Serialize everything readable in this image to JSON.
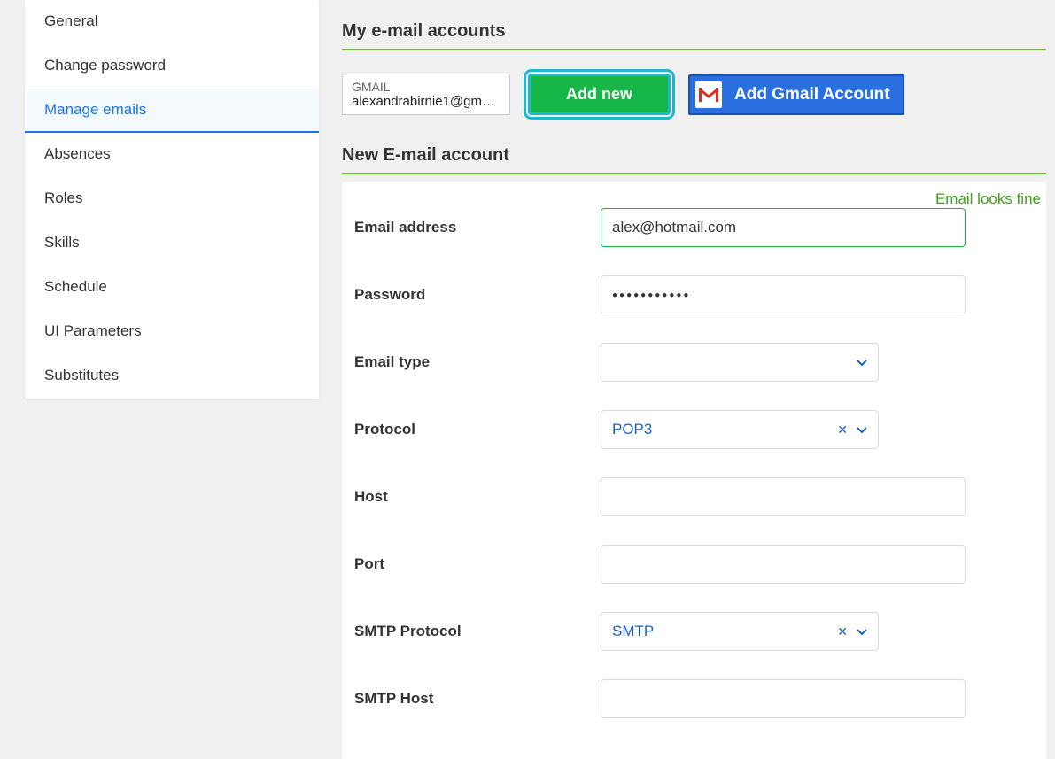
{
  "sidebar": {
    "items": [
      {
        "label": "General"
      },
      {
        "label": "Change password"
      },
      {
        "label": "Manage emails"
      },
      {
        "label": "Absences"
      },
      {
        "label": "Roles"
      },
      {
        "label": "Skills"
      },
      {
        "label": "Schedule"
      },
      {
        "label": "UI Parameters"
      },
      {
        "label": "Substitutes"
      }
    ],
    "active_index": 2
  },
  "sections": {
    "accounts_title": "My e-mail accounts",
    "new_account_title": "New E-mail account"
  },
  "existing_account": {
    "provider": "GMAIL",
    "email": "alexandrabirnie1@gmail..."
  },
  "buttons": {
    "add_new": "Add new",
    "add_gmail": "Add Gmail Account"
  },
  "status": {
    "email_ok": "Email looks fine"
  },
  "form": {
    "email_address": {
      "label": "Email address",
      "value": "alex@hotmail.com"
    },
    "password": {
      "label": "Password",
      "value_masked": "●●●●●●●●●●●"
    },
    "email_type": {
      "label": "Email type",
      "value": ""
    },
    "protocol": {
      "label": "Protocol",
      "value": "POP3"
    },
    "host": {
      "label": "Host",
      "value": ""
    },
    "port": {
      "label": "Port",
      "value": ""
    },
    "smtp_protocol": {
      "label": "SMTP Protocol",
      "value": "SMTP"
    },
    "smtp_host": {
      "label": "SMTP Host",
      "value": ""
    }
  }
}
